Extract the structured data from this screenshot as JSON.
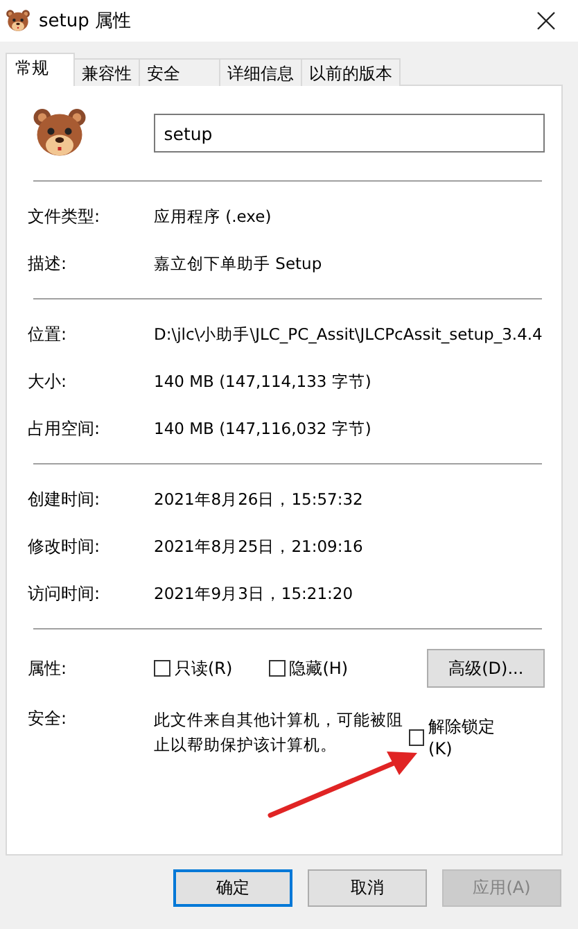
{
  "window": {
    "title": "setup 属性"
  },
  "tabs": [
    {
      "label": "常规",
      "selected": true
    },
    {
      "label": "兼容性",
      "selected": false
    },
    {
      "label": "安全",
      "selected": false
    },
    {
      "label": "详细信息",
      "selected": false
    },
    {
      "label": "以前的版本",
      "selected": false
    }
  ],
  "file_name": {
    "value": "setup"
  },
  "groups": [
    [
      {
        "label": "文件类型:",
        "value": "应用程序 (.exe)"
      },
      {
        "label": "描述:",
        "value": "嘉立创下单助手 Setup"
      }
    ],
    [
      {
        "label": "位置:",
        "value": "D:\\jlc\\小助手\\JLC_PC_Assit\\JLCPcAssit_setup_3.4.4"
      },
      {
        "label": "大小:",
        "value": "140 MB (147,114,133 字节)"
      },
      {
        "label": "占用空间:",
        "value": "140 MB (147,116,032 字节)"
      }
    ],
    [
      {
        "label": "创建时间:",
        "value": "2021年8月26日，15:57:32"
      },
      {
        "label": "修改时间:",
        "value": "2021年8月25日，21:09:16"
      },
      {
        "label": "访问时间:",
        "value": "2021年9月3日，15:21:20"
      }
    ]
  ],
  "attributes": {
    "label": "属性:",
    "checkboxes": [
      {
        "label": "只读(R)",
        "checked": false
      },
      {
        "label": "隐藏(H)",
        "checked": false
      }
    ],
    "advanced_button": "高级(D)..."
  },
  "security": {
    "label": "安全:",
    "text": "此文件来自其他计算机，可能被阻止以帮助保护该计算机。",
    "checkbox": {
      "label": "解除锁定(K)",
      "checked": false
    }
  },
  "buttons": [
    {
      "label": "确定",
      "focused": true,
      "disabled": false
    },
    {
      "label": "取消",
      "focused": false,
      "disabled": false
    },
    {
      "label": "应用(A)",
      "focused": false,
      "disabled": true
    }
  ]
}
